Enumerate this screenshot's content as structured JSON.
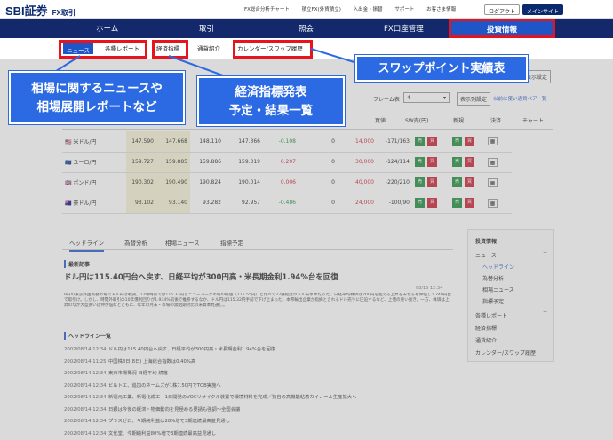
{
  "header": {
    "logo": "SBI証券",
    "logo_sub": "FX取引",
    "links": [
      "FX総合分析チャート",
      "積立FX(外貨積立)",
      "入出金・振替",
      "サポート",
      "お客さま情報"
    ],
    "logout": "ログアウト",
    "main_site": "メインサイト"
  },
  "nav": {
    "items": [
      "ホーム",
      "取引",
      "照会",
      "FX口座管理"
    ],
    "active": "投資情報"
  },
  "subnav": {
    "news": "ニュース",
    "report": "各種レポート",
    "indicator": "経済指標",
    "intro": "通貨紹介",
    "calendar": "カレンダー/スワップ履歴"
  },
  "callouts": {
    "swap": "スワップポイント実績表",
    "news": "相場に関するニュースや\n相場展開レポートなど",
    "indicator": "経済指標発表\n予定・結果一覧"
  },
  "rate_panel": {
    "display_setting": "表示設定",
    "frame_label": "フレーム表",
    "frame_value": "4",
    "frame_btn": "表示列設定",
    "show_currency": "以前に使い通貨ペア一覧",
    "cols": [
      "買値",
      "SW売(円)",
      "新規",
      "決済",
      "チャート"
    ],
    "rows": [
      {
        "pair": "米ドル/円",
        "flag": "🇺🇸",
        "v": [
          "147.590",
          "147.668",
          "148.110",
          "147.366",
          "-0.108",
          "0",
          "14,000",
          "-171/163"
        ]
      },
      {
        "pair": "ユーロ/円",
        "flag": "🇪🇺",
        "v": [
          "159.727",
          "159.885",
          "159.886",
          "159.319",
          "0.207",
          "0",
          "30,000",
          "-124/114"
        ]
      },
      {
        "pair": "ポンド/円",
        "flag": "🇬🇧",
        "v": [
          "190.302",
          "190.490",
          "190.824",
          "190.014",
          "0.006",
          "0",
          "40,000",
          "-220/210"
        ]
      },
      {
        "pair": "豪ドル/円",
        "flag": "🇦🇺",
        "v": [
          "93.102",
          "93.140",
          "93.282",
          "92.957",
          "-0.486",
          "0",
          "24,000",
          "-100/90"
        ]
      }
    ],
    "buy": "売",
    "sell": "買"
  },
  "tabs": [
    "ヘッドライン",
    "為替分析",
    "相場ニュース",
    "指標予定"
  ],
  "latest": {
    "label": "最新記事",
    "title": "ドル円は115.40円台へ戻す、日経平均が300円高・米長期金利1.94%台を回復",
    "date": "08/15 12:34",
    "body": "9日の東京外国為替市場でドル円は軟調。12時時点では115.33円とニューヨーク市場の終値（115.55円）と比べて22銭程度のドル安水準だった。日経平均株価は200円を超える上昇をみせるも伸悩して240円台で取引け。しかし、時間外取引の10年債利回りが1.934%前後で推移するなか、ドル円は115.32円手前で下げ止まった。本邦輸出企業が指摘とされるドル売りに圧迫するなど、上値の重い動き。一方、株価は上昇のなか大型買いは伸び悩むとともに、昨年の月末・市場の需給期対比の米資本見通し。"
  },
  "headlines": {
    "label": "ヘッドライン一覧",
    "items": [
      {
        "d": "2002/08/14 12:34",
        "t": "ドル円は115.40円台へ戻す、日経平均が300円高・米長期金利1.94%台を回復"
      },
      {
        "d": "2002/08/14 11:25",
        "t": "中国株8日(8日) 上海総合指数は0.40%高"
      },
      {
        "d": "2002/08/14 12:34",
        "t": "東京市場概況 日経平均 続落"
      },
      {
        "d": "2002/08/14 12:34",
        "t": "ビルトエ、追加のネームズが1株7.50円でTOB実施へ"
      },
      {
        "d": "2002/08/14 12:34",
        "t": "新電元工業、新電化成工　1日開発のVOCリサイクル装置で環境材料を完成／独自の高機能粘着カイノール生産拡大へ"
      },
      {
        "d": "2002/08/14 12:34",
        "t": "日銀は今後の経済・物価動向を見極める要請も強調～全国会議"
      },
      {
        "d": "2002/08/14 12:34",
        "t": "プラスゼロ、今期純利益は28%増で3期連続最高益見通し"
      },
      {
        "d": "2002/08/14 12:34",
        "t": "文化堂、今期純利益80%増で3期連続最高益見通し"
      }
    ]
  },
  "side": {
    "title": "投資情報",
    "items": [
      "ニュース",
      "ヘッドライン",
      "為替分析",
      "相場ニュース",
      "指標予定",
      "各種レポート",
      "経済指標",
      "通貨紹介",
      "カレンダー/スワップ履歴"
    ]
  }
}
